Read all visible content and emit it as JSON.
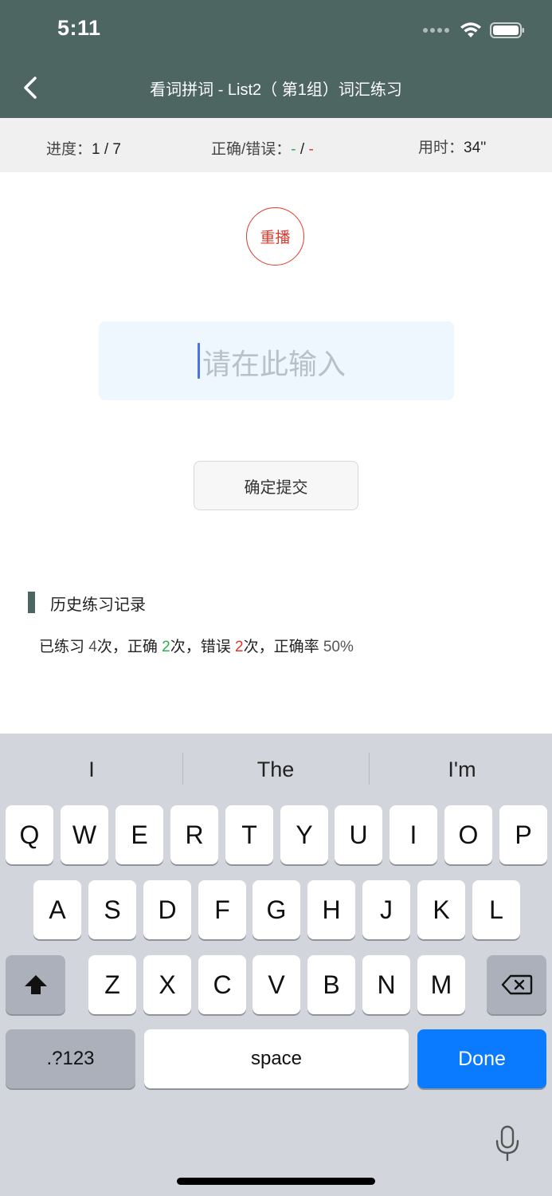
{
  "status_bar": {
    "time": "5:11"
  },
  "header": {
    "title": "看词拼词 - List2（ 第1组）词汇练习"
  },
  "stats": {
    "progress_label": "进度：",
    "progress_value": "1 / 7",
    "correct_wrong_label": "正确/错误：",
    "correct_value": "-",
    "separator": "/",
    "wrong_value": "-",
    "time_label": "用时：",
    "time_value": "34''"
  },
  "replay": {
    "label": "重播"
  },
  "answer_input": {
    "placeholder": "请在此输入",
    "value": ""
  },
  "submit": {
    "label": "确定提交"
  },
  "history": {
    "title": "历史练习记录",
    "prefix": "已练习 ",
    "practiced_count": "4",
    "practiced_suffix": "次，正确 ",
    "correct_count": "2",
    "correct_suffix": "次，错误 ",
    "wrong_count": "2",
    "wrong_suffix": "次，正确率 ",
    "accuracy": "50%"
  },
  "keyboard": {
    "suggestions": [
      "I",
      "The",
      "I'm"
    ],
    "row1": [
      "Q",
      "W",
      "E",
      "R",
      "T",
      "Y",
      "U",
      "I",
      "O",
      "P"
    ],
    "row2": [
      "A",
      "S",
      "D",
      "F",
      "G",
      "H",
      "J",
      "K",
      "L"
    ],
    "row3": [
      "Z",
      "X",
      "C",
      "V",
      "B",
      "N",
      "M"
    ],
    "numbers_key": ".?123",
    "space_key": "space",
    "done_key": "Done"
  },
  "colors": {
    "header_bg": "#4e6661",
    "accent_red": "#e0392b",
    "accent_green": "#2bb24c",
    "done_blue": "#0a7aff",
    "input_bg": "#eef7fd"
  }
}
